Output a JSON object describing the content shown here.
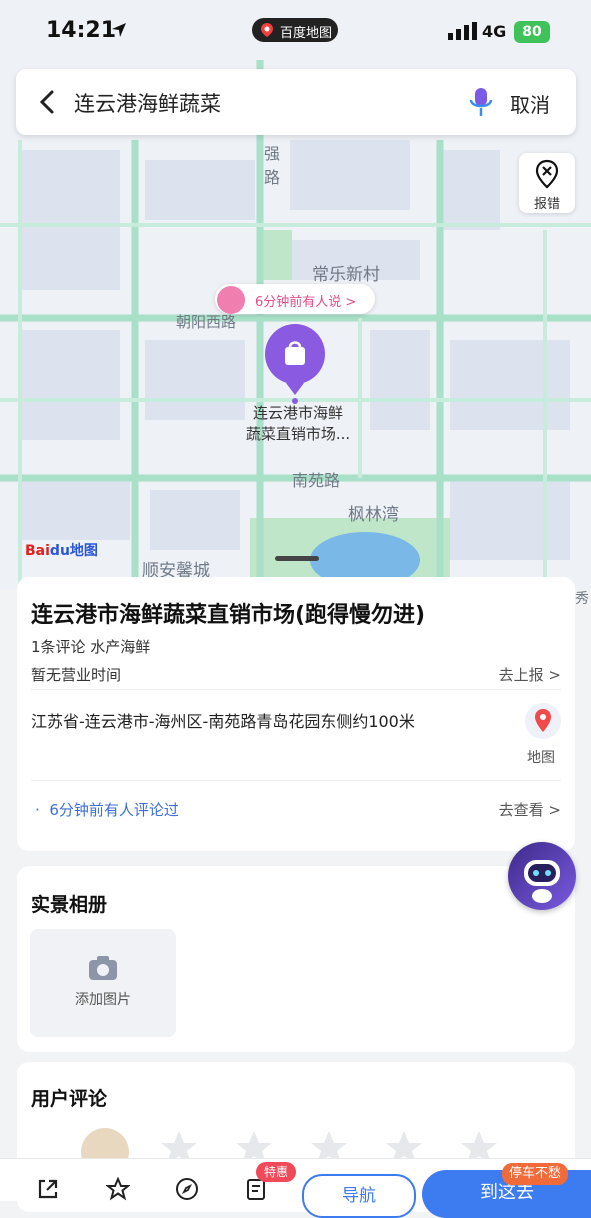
{
  "status_bar": {
    "time": "14:21",
    "app_name": "百度地图",
    "network": "4G",
    "battery": "80"
  },
  "search": {
    "query": "连云港海鲜蔬菜",
    "cancel_label": "取消"
  },
  "map": {
    "report_label": "报错",
    "roads": [
      "强",
      "路",
      "常乐新村",
      "朝阳西路",
      "南苑路",
      "枫林湾",
      "顺安馨城",
      "秀"
    ],
    "bubble_text": "6分钟前有人说 >",
    "poi_label_line1": "连云港市海鲜",
    "poi_label_line2": "蔬菜直销市场...",
    "logo_text": "Bai",
    "logo_text2": "du地图"
  },
  "poi": {
    "title": "连云港市海鲜蔬菜直销市场(跑得慢勿进)",
    "meta": "1条评论  水产海鲜",
    "hours": "暂无营业时间",
    "report_link": "去上报 >",
    "address": "江苏省-连云港市-海州区-南苑路青岛花园东侧约100米",
    "map_label": "地图",
    "review_note": "6分钟前有人评论过",
    "review_link": "去查看 >"
  },
  "album": {
    "title": "实景相册",
    "add_photo_label": "添加图片"
  },
  "reviews": {
    "title": "用户评论"
  },
  "bottom": {
    "tehui": "特惠",
    "navigate": "导航",
    "go_here": "到这去",
    "parking": "停车不愁"
  },
  "colors": {
    "accent": "#3d7bf0",
    "poi_purple": "#8a5ae0",
    "road_green": "#a8e0c8"
  }
}
